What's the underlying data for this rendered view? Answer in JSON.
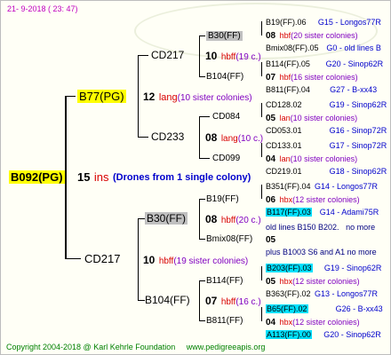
{
  "header": {
    "timestamp": "21-  9-2018  (  23:  47)"
  },
  "root": {
    "name": "B092(PG)",
    "count": "15",
    "text": "ins",
    "note": "(Drones from 1 single colony)"
  },
  "queen_upper": {
    "name": "B77(PG)",
    "count": "12",
    "text": "lang",
    "note": "(10 sister colonies)"
  },
  "queen_upper_mother": {
    "name": "CD217",
    "count": "10",
    "text": "hbff",
    "note": "(19 c.)"
  },
  "queen_upper_drone": {
    "name": "CD233",
    "count": "08",
    "text": "lang",
    "note": "(10 c.)"
  },
  "uu_mother": {
    "name": "B30(FF)",
    "count": "08",
    "text": "hbf",
    "note": "(20 sister colonies)"
  },
  "uu_drone": {
    "name": "B104(FF)",
    "count": "07",
    "text": "hbf",
    "note": "(16 sister colonies)"
  },
  "ud_mother": {
    "name": "CD084",
    "count": "05",
    "text": "lan",
    "note": "(10 sister colonies)"
  },
  "ud_drone": {
    "name": "CD099",
    "count": "04",
    "text": "lan",
    "note": "(10 sister colonies)"
  },
  "queen_lower": {
    "name": "CD217",
    "count": "10",
    "text": "hbff",
    "note": "(19 sister colonies)"
  },
  "queen_lower_mother": {
    "name": "B30(FF)",
    "count": "08",
    "text": "hbff",
    "note": "(20 c.)"
  },
  "queen_lower_drone": {
    "name": "B104(FF)",
    "count": "07",
    "text": "hbff",
    "note": "(16 c.)"
  },
  "lu_mother": {
    "name": "B19(FF)",
    "count": "06",
    "text": "hbx",
    "note": "(12 sister colonies)"
  },
  "lu_drone": {
    "name": "Bmix08(FF)",
    "count": "05",
    "text": ""
  },
  "ld_mother": {
    "name": "B114(FF)",
    "count": "05",
    "text": "hbx",
    "note": "(12 sister colonies)"
  },
  "ld_drone": {
    "name": "B811(FF)",
    "count": "04",
    "text": "hbx",
    "note": "(12 sister colonies)"
  },
  "leaves": [
    {
      "name": "B19(FF).06",
      "code": "G15 - Longos77R"
    },
    {
      "name": "Bmix08(FF).05",
      "code": "G0 - old lines B"
    },
    {
      "name": "B114(FF).05",
      "code": "G20 - Sinop62R"
    },
    {
      "name": "B811(FF).04",
      "code": "G27 - B-xx43"
    },
    {
      "name": "CD128.02",
      "code": "G19 - Sinop62R"
    },
    {
      "name": "CD053.01",
      "code": "G16 - Sinop72R"
    },
    {
      "name": "CD133.01",
      "code": "G17 - Sinop72R"
    },
    {
      "name": "CD219.01",
      "code": "G18 - Sinop62R"
    },
    {
      "name": "B351(FF).04",
      "code": "G14 - Longos77R"
    },
    {
      "name": "B117(FF).03",
      "code": "G14 - Adami75R"
    },
    {
      "name": "B203(FF).03",
      "code": "G19 - Sinop62R"
    },
    {
      "name": "B363(FF).02",
      "code": "G13 - Longos77R"
    },
    {
      "name": "B65(FF).02",
      "code": "G26 - B-xx43"
    },
    {
      "name": "A113(FF).00",
      "code": "G20 - Sinop62R"
    }
  ],
  "drone_note": {
    "line1": "old lines B150 B202.",
    "line1b": "no more",
    "line2": "plus B1003 S6 and A1",
    "line2b": "no more"
  },
  "footer": {
    "copyright": "Copyright 2004-2018 @ Karl Kehrle Foundation",
    "site": "www.pedigreeapis.org"
  },
  "colors": {
    "accent": "#d80000",
    "note": "#8000c0",
    "code": "#0000cc",
    "highlight_yellow": "#ffff00",
    "highlight_cyan": "#00e0ff",
    "highlight_gray": "#c0c0c0"
  }
}
